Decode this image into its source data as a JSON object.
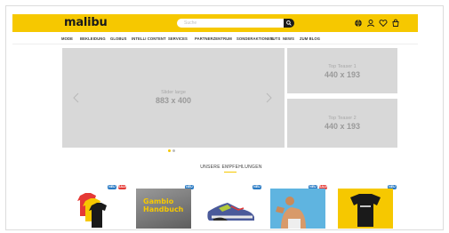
{
  "header": {
    "logo": "malibu",
    "search_placeholder": "Suche",
    "icons": [
      "globe-icon",
      "user-icon",
      "heart-icon",
      "bag-icon"
    ],
    "accent_color": "#f6c800"
  },
  "nav": {
    "items": [
      "MODE",
      "BEKLEIDUNG",
      "GLOBUS",
      "INTELLI CONTENT",
      "SERVICES",
      "PARTNERZENTRUM",
      "SONDERAKTIONEN",
      "TUTS",
      "NEWS",
      "ZUM BLOG"
    ]
  },
  "hero": {
    "slider": {
      "caption": "Slider large",
      "size": "883 x 400",
      "active_slide": 1,
      "slide_count": 2
    },
    "teaser1": {
      "caption": "Top Teaser 1",
      "size": "440 x 193"
    },
    "teaser2": {
      "caption": "Top Teaser 2",
      "size": "440 x 193"
    }
  },
  "recommendations": {
    "title": "UNSERE EMPFEHLUNGEN",
    "products": [
      {
        "image": "t-shirts-product",
        "badges": [
          "NEU",
          "SALE"
        ]
      },
      {
        "image": "book-product",
        "book_title": "Gambio Handbuch",
        "badges": [
          "NEU"
        ]
      },
      {
        "image": "sneaker-product",
        "badges": [
          "NEU"
        ]
      },
      {
        "image": "person-product",
        "badges": [
          "NEU",
          "SALE"
        ]
      },
      {
        "image": "black-shirt-product",
        "badges": [
          "NEU"
        ]
      }
    ]
  }
}
